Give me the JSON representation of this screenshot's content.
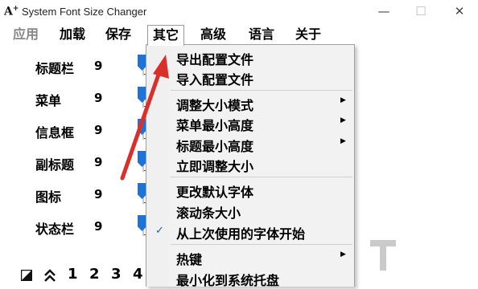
{
  "window": {
    "app_icon_letter": "A",
    "app_icon_plus": "+",
    "title": "System Font Size Changer",
    "minimize_glyph": "—",
    "maximize_glyph": "☐",
    "close_glyph": "✕"
  },
  "menubar": {
    "items": [
      {
        "label": "应用",
        "state": "disabled"
      },
      {
        "label": "加载",
        "state": "normal"
      },
      {
        "label": "保存",
        "state": "normal"
      },
      {
        "label": "其它",
        "state": "open"
      },
      {
        "label": "高级",
        "state": "normal"
      },
      {
        "label": "语言",
        "state": "normal"
      },
      {
        "label": "关于",
        "state": "normal"
      }
    ]
  },
  "rows": [
    {
      "label": "标题栏",
      "value": "9"
    },
    {
      "label": "菜单",
      "value": "9"
    },
    {
      "label": "信息框",
      "value": "9"
    },
    {
      "label": "副标题",
      "value": "9"
    },
    {
      "label": "图标",
      "value": "9"
    },
    {
      "label": "状态栏",
      "value": "9"
    }
  ],
  "bottom_bar": {
    "icons": [
      "corner-arrow-icon",
      "double-chevron-up-icon"
    ],
    "numbers": [
      "1",
      "2",
      "3",
      "4"
    ]
  },
  "context_menu": {
    "items": [
      {
        "label": "导出配置文件",
        "submenu": false,
        "checked": false
      },
      {
        "label": "导入配置文件",
        "submenu": false,
        "checked": false
      },
      {
        "label": "调整大小模式",
        "submenu": true,
        "checked": false
      },
      {
        "label": "菜单最小高度",
        "submenu": true,
        "checked": false
      },
      {
        "label": "标题最小高度",
        "submenu": true,
        "checked": false
      },
      {
        "label": "立即调整大小",
        "submenu": false,
        "checked": false
      },
      {
        "label": "更改默认字体",
        "submenu": false,
        "checked": false
      },
      {
        "label": "滚动条大小",
        "submenu": false,
        "checked": false
      },
      {
        "label": "从上次使用的字体开始",
        "submenu": false,
        "checked": true
      },
      {
        "label": "热键",
        "submenu": true,
        "checked": false
      },
      {
        "label": "最小化到系统托盘",
        "submenu": false,
        "checked": false
      }
    ],
    "submenu_glyph": "▶",
    "check_glyph": "✓"
  },
  "colors": {
    "slider_thumb": "#1e73d8",
    "annotation_arrow": "#d9302c",
    "check_mark": "#1a5fb4"
  }
}
